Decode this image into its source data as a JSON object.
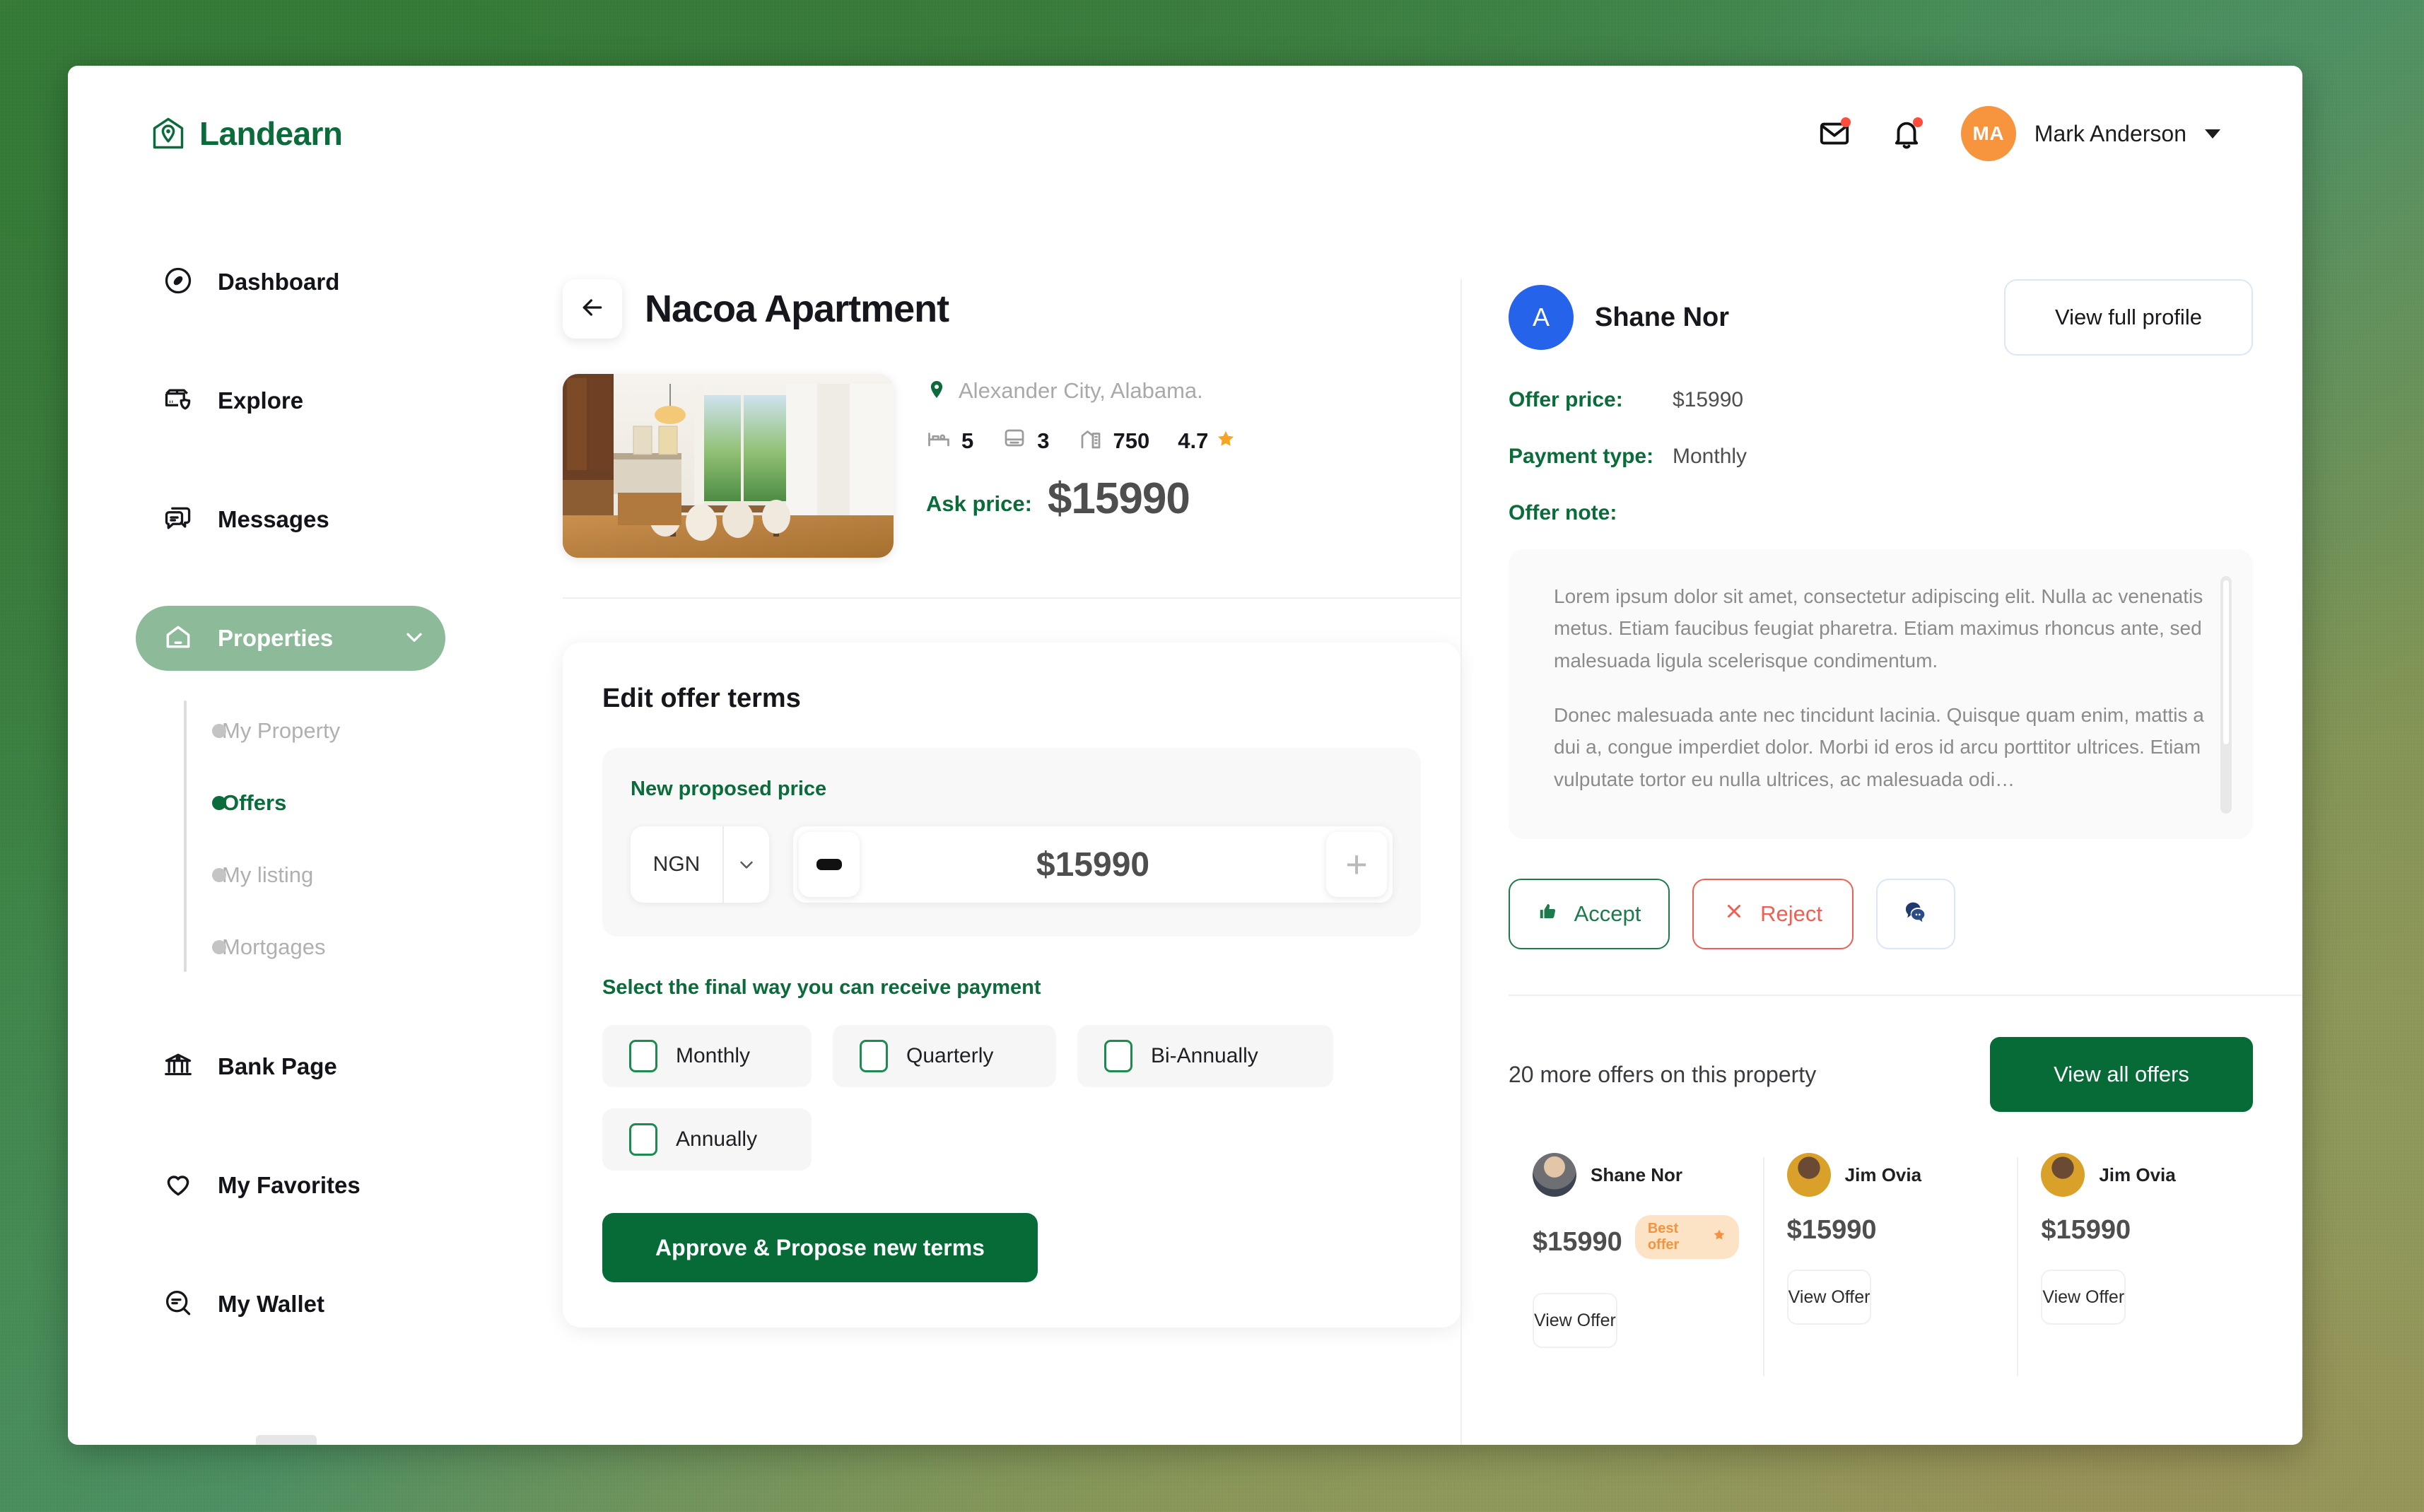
{
  "brand": {
    "name": "Landearn",
    "color": "#0b6b3a"
  },
  "header": {
    "user_name": "Mark Anderson",
    "avatar_initials": "MA",
    "avatar_color": "#f7943e",
    "mail_icon": "mail-icon",
    "bell_icon": "bell-icon",
    "caret_icon": "chevron-down-icon"
  },
  "sidebar": {
    "items": [
      {
        "label": "Dashboard",
        "icon": "compass-icon",
        "active": false
      },
      {
        "label": "Explore",
        "icon": "explore-shield-icon",
        "active": false
      },
      {
        "label": "Messages",
        "icon": "chat-icon",
        "active": false
      },
      {
        "label": "Properties",
        "icon": "home-icon",
        "active": true
      },
      {
        "label": "Bank Page",
        "icon": "bank-icon",
        "active": false
      },
      {
        "label": "My Favorites",
        "icon": "heart-icon",
        "active": false
      },
      {
        "label": "My Wallet",
        "icon": "wallet-search-icon",
        "active": false
      }
    ],
    "subitems": [
      {
        "label": "My Property",
        "active": false
      },
      {
        "label": "Offers",
        "active": true
      },
      {
        "label": "My listing",
        "active": false
      },
      {
        "label": "Mortgages",
        "active": false
      }
    ],
    "active_color": "#8dbb9a",
    "active_text_color": "#0b6b3a"
  },
  "property": {
    "back_icon": "arrow-left-icon",
    "title": "Nacoa Apartment",
    "location": "Alexander City, Alabama.",
    "location_icon": "map-pin-icon",
    "specs": [
      {
        "icon": "bed-icon",
        "value": "5"
      },
      {
        "icon": "bath-icon",
        "value": "3"
      },
      {
        "icon": "area-icon",
        "value": "750"
      }
    ],
    "rating": "4.7",
    "rating_icon": "star-icon",
    "ask_price_label": "Ask price:",
    "ask_price": "$15990"
  },
  "edit_offer": {
    "title": "Edit offer terms",
    "price_label": "New proposed price",
    "currency": "NGN",
    "currency_arrow": "chevron-down-icon",
    "decrement_icon": "minus-icon",
    "increment_icon": "plus-icon",
    "amount": "$15990",
    "payment_label": "Select the final way you can receive payment",
    "payment_options": [
      {
        "label": "Monthly",
        "checked": false
      },
      {
        "label": "Quarterly",
        "checked": false
      },
      {
        "label": "Bi-Annually",
        "checked": false
      },
      {
        "label": "Annually",
        "checked": false
      }
    ],
    "submit_label": "Approve & Propose new terms"
  },
  "offer_detail": {
    "avatar_initial": "A",
    "avatar_color": "#2563eb",
    "name": "Shane Nor",
    "view_profile_label": "View full profile",
    "fields": [
      {
        "key": "Offer price:",
        "value": "$15990"
      },
      {
        "key": "Payment type:",
        "value": "Monthly"
      }
    ],
    "note_label": "Offer note:",
    "note_paragraph_1": "Lorem ipsum dolor sit amet, consectetur adipiscing elit. Nulla ac venenatis metus. Etiam faucibus feugiat pharetra. Etiam maximus rhoncus ante, sed malesuada ligula scelerisque condimentum.",
    "note_paragraph_2": "Donec malesuada ante nec tincidunt lacinia. Quisque quam enim, mattis a dui a, congue imperdiet dolor. Morbi id eros id arcu porttitor ultrices. Etiam vulputate tortor eu nulla ultrices, ac malesuada odi…",
    "accept_label": "Accept",
    "accept_icon": "thumbs-up-icon",
    "reject_label": "Reject",
    "reject_icon": "close-x-icon",
    "chat_icon": "chat-bubbles-icon"
  },
  "more_offers": {
    "count_text": "20 more offers on this property",
    "view_all_label": "View all offers",
    "cards": [
      {
        "name": "Shane Nor",
        "price": "$15990",
        "badge": "Best offer",
        "badge_icon": "star-icon",
        "action": "View Offer"
      },
      {
        "name": "Jim Ovia",
        "price": "$15990",
        "badge": null,
        "action": "View Offer"
      },
      {
        "name": "Jim Ovia",
        "price": "$15990",
        "badge": null,
        "action": "View Offer"
      }
    ]
  }
}
